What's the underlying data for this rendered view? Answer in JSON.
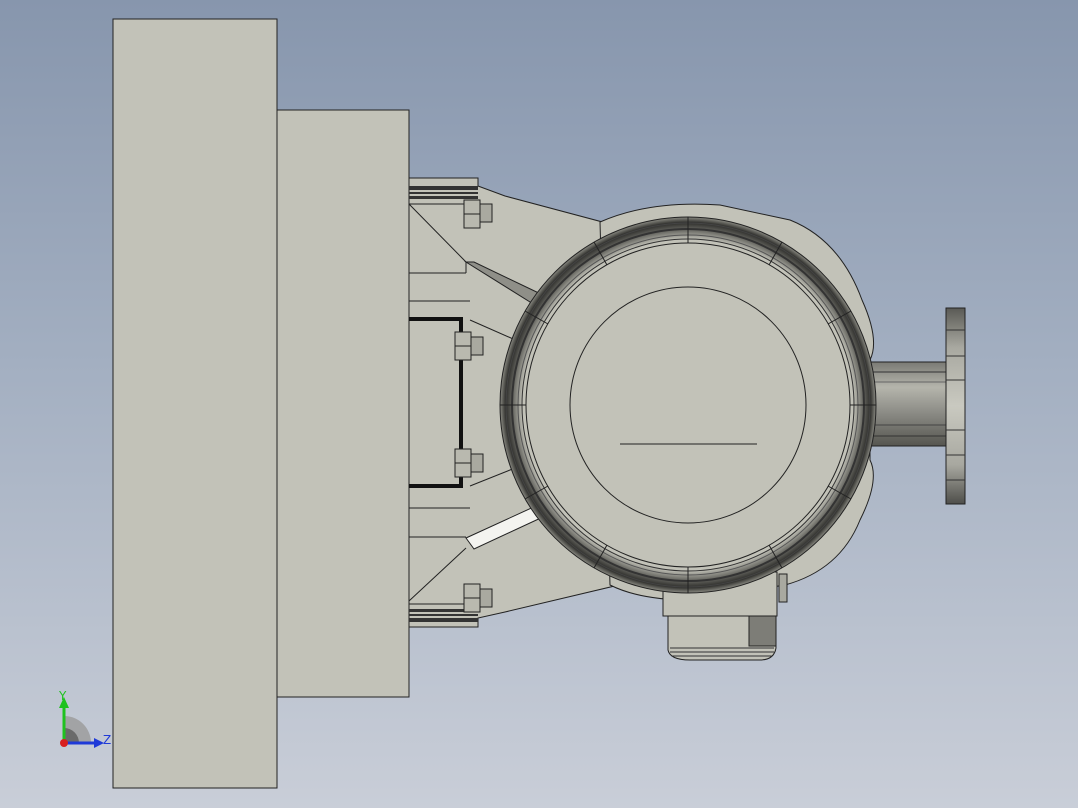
{
  "viewport": {
    "background_top": "#8796ad",
    "background_bottom": "#c9ced8",
    "part_fill": "#c2c2b8",
    "part_stroke": "#222222"
  },
  "triad": {
    "y_label": "Y",
    "z_label": "Z",
    "y_color": "#1fc21f",
    "z_color": "#1f3ad8",
    "x_color": "#d81f1f"
  }
}
